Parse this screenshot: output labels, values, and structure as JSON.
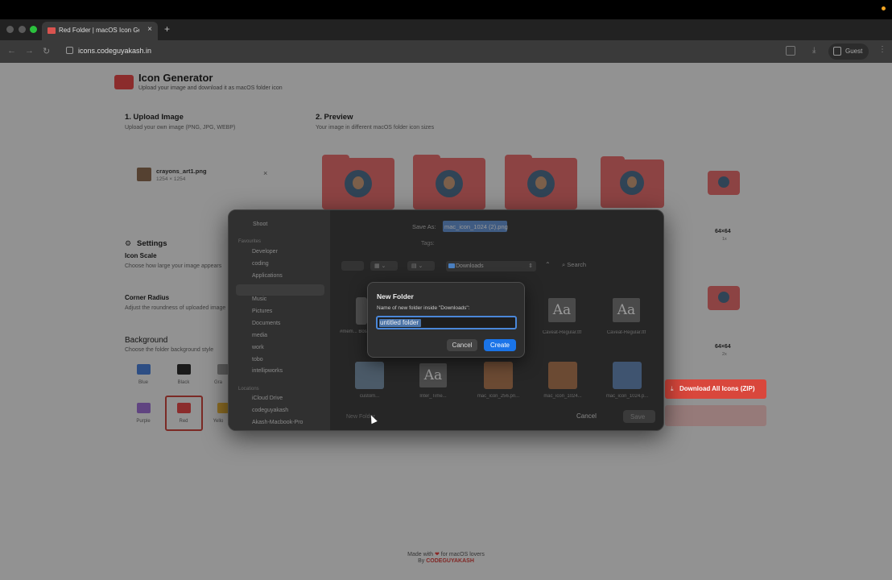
{
  "browser": {
    "tab_title": "Red Folder | macOS Icon Gen",
    "url": "icons.codeguyakash.in",
    "guest_label": "Guest",
    "new_tab": "+",
    "tab_close": "×"
  },
  "header": {
    "title": "Icon Generator",
    "subtitle": "Upload your image and download it as macOS folder icon"
  },
  "upload": {
    "title": "1. Upload Image",
    "subtitle": "Upload your own image (PNG, JPG, WEBP)",
    "file_name": "crayons_art1.png",
    "file_dims": "1254 × 1254",
    "remove": "×"
  },
  "preview": {
    "title": "2. Preview",
    "subtitle": "Your image in different macOS folder icon sizes",
    "size_1x": "64×64",
    "scale_1x": "1x",
    "size_2x": "64×64",
    "scale_2x": "2x"
  },
  "settings": {
    "title": "Settings",
    "icon_scale_label": "Icon Scale",
    "icon_scale_desc": "Choose how large your image appears",
    "corner_radius_label": "Corner Radius",
    "corner_radius_desc": "Adjust the roundness of uploaded image",
    "background_label": "Background",
    "background_desc": "Choose the folder background style",
    "swatches": [
      {
        "label": "Blue",
        "color": "#4a7fd6"
      },
      {
        "label": "Black",
        "color": "#2a2a2a"
      },
      {
        "label": "Gra",
        "color": "#9a9a9a"
      },
      {
        "label": "Purple",
        "color": "#9b6fd0"
      },
      {
        "label": "Red",
        "color": "#e04848"
      },
      {
        "label": "Yello",
        "color": "#e6b23a"
      }
    ],
    "selected_swatch": "Red"
  },
  "download_button": "Download All Icons (ZIP)",
  "footer": {
    "line1_prefix": "Made with",
    "heart": "❤",
    "line1_suffix": "for macOS lovers",
    "line2_prefix": "By",
    "brand": "CODEGUYAKASH"
  },
  "save_dialog": {
    "save_as_label": "Save As:",
    "save_as_value": "mac_icon_1024 (2).png",
    "tags_label": "Tags:",
    "location": "Downloads",
    "search_placeholder": "Search",
    "sidebar": {
      "top_item": "Shoot",
      "favorites_head": "Favourites",
      "favorites": [
        "Developer",
        "coding",
        "Applications",
        "",
        "Music",
        "Pictures",
        "Documents",
        "media",
        "work",
        "tobo",
        "intellipworks"
      ],
      "locations_head": "Locations",
      "locations": [
        "iCloud Drive",
        "codeguyakash",
        "Akash-Macbook-Pro"
      ]
    },
    "files_row1": [
      {
        "label": "#mem... Bossa.p..."
      },
      {
        "label": "Caveat-Regular.ttf",
        "glyph": "Aa"
      },
      {
        "label": "Caveat-Regular.ttf",
        "glyph": "Aa"
      }
    ],
    "files_row2": [
      {
        "label": "custom..."
      },
      {
        "label": "Inter_Time...",
        "glyph": "Aa"
      },
      {
        "label": "mac_icon_256.pn..."
      },
      {
        "label": "mac_icon_1024..."
      },
      {
        "label": "mac_icon_1024.p..."
      }
    ],
    "new_folder_button": "New Folder",
    "cancel": "Cancel",
    "save": "Save"
  },
  "new_folder_sheet": {
    "title": "New Folder",
    "description": "Name of new folder inside \"Downloads\":",
    "input_value": "untitled folder",
    "cancel": "Cancel",
    "create": "Create"
  },
  "colors": {
    "accent_red": "#d9473c",
    "create_blue": "#1a74e8",
    "folder_red": "#e36c6c"
  }
}
